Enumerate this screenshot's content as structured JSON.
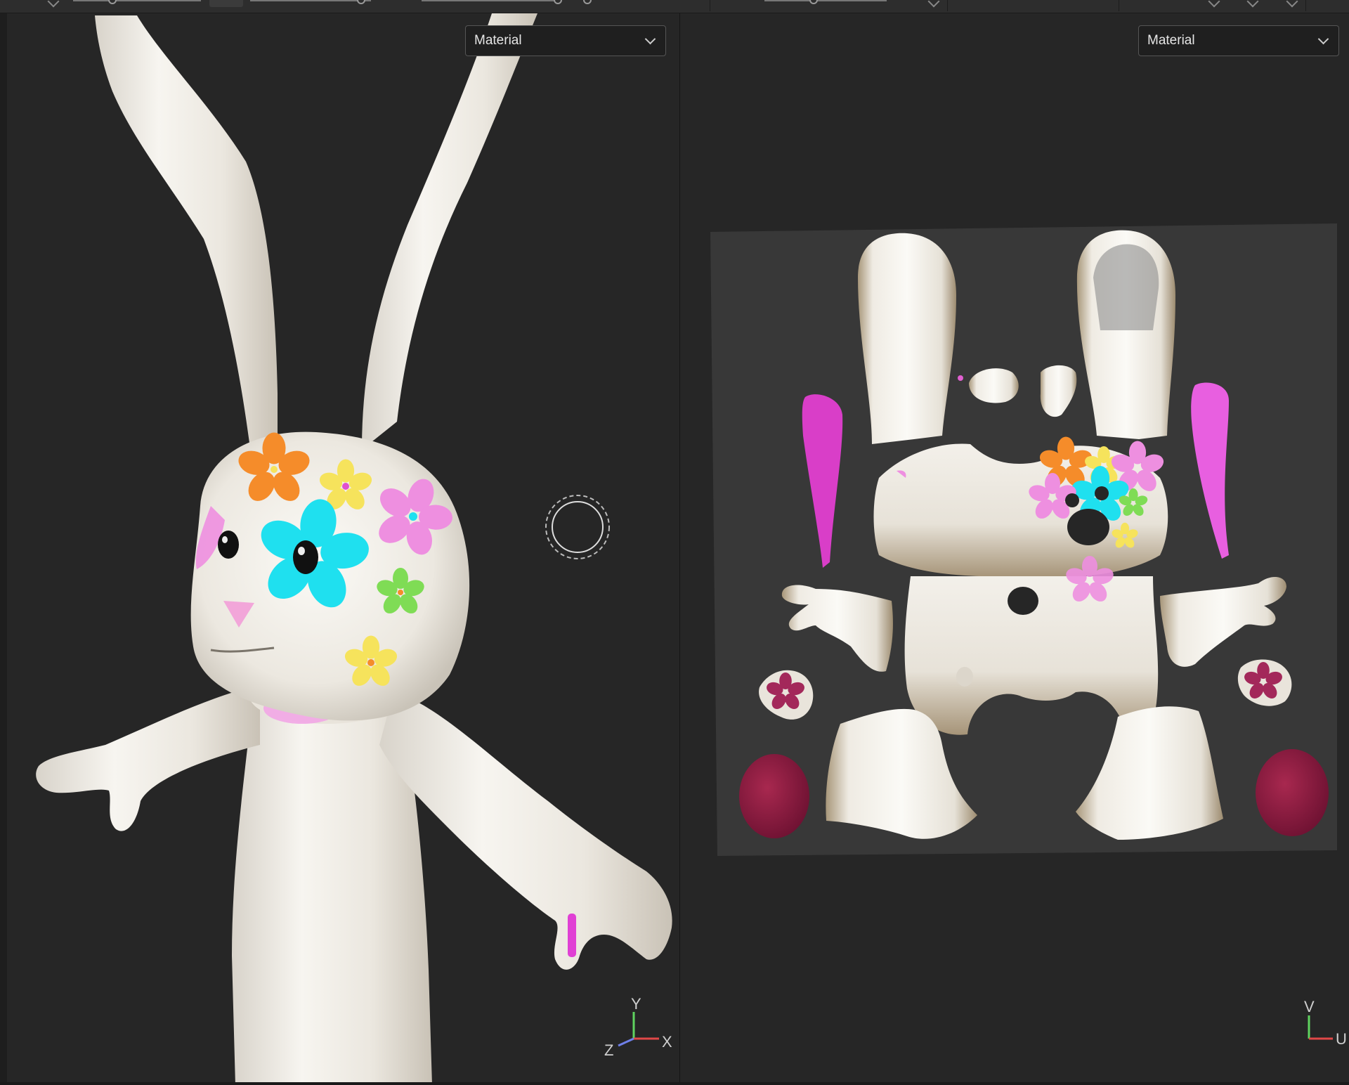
{
  "viewport_3d": {
    "shading_mode": "Material",
    "axis_labels": {
      "y": "Y",
      "x": "X",
      "z": "Z"
    }
  },
  "viewport_uv": {
    "shading_mode": "Material",
    "axis_labels": {
      "v": "V",
      "u": "U"
    }
  },
  "icons": {
    "dropdown": "chevron-down-icon",
    "brush": "brush-cursor-icon",
    "gizmo": "axis-gizmo-icon"
  },
  "colors": {
    "background": "#262626",
    "uv_canvas": "#383838",
    "fur": "#efece6",
    "flower_cyan": "#1fe0ef",
    "flower_orange": "#f58c2a",
    "flower_pink": "#ee8fe0",
    "flower_yellow": "#f6e35c",
    "flower_green": "#7fdc55",
    "magenta": "#d93ec8",
    "maroon": "#8e1a40"
  }
}
